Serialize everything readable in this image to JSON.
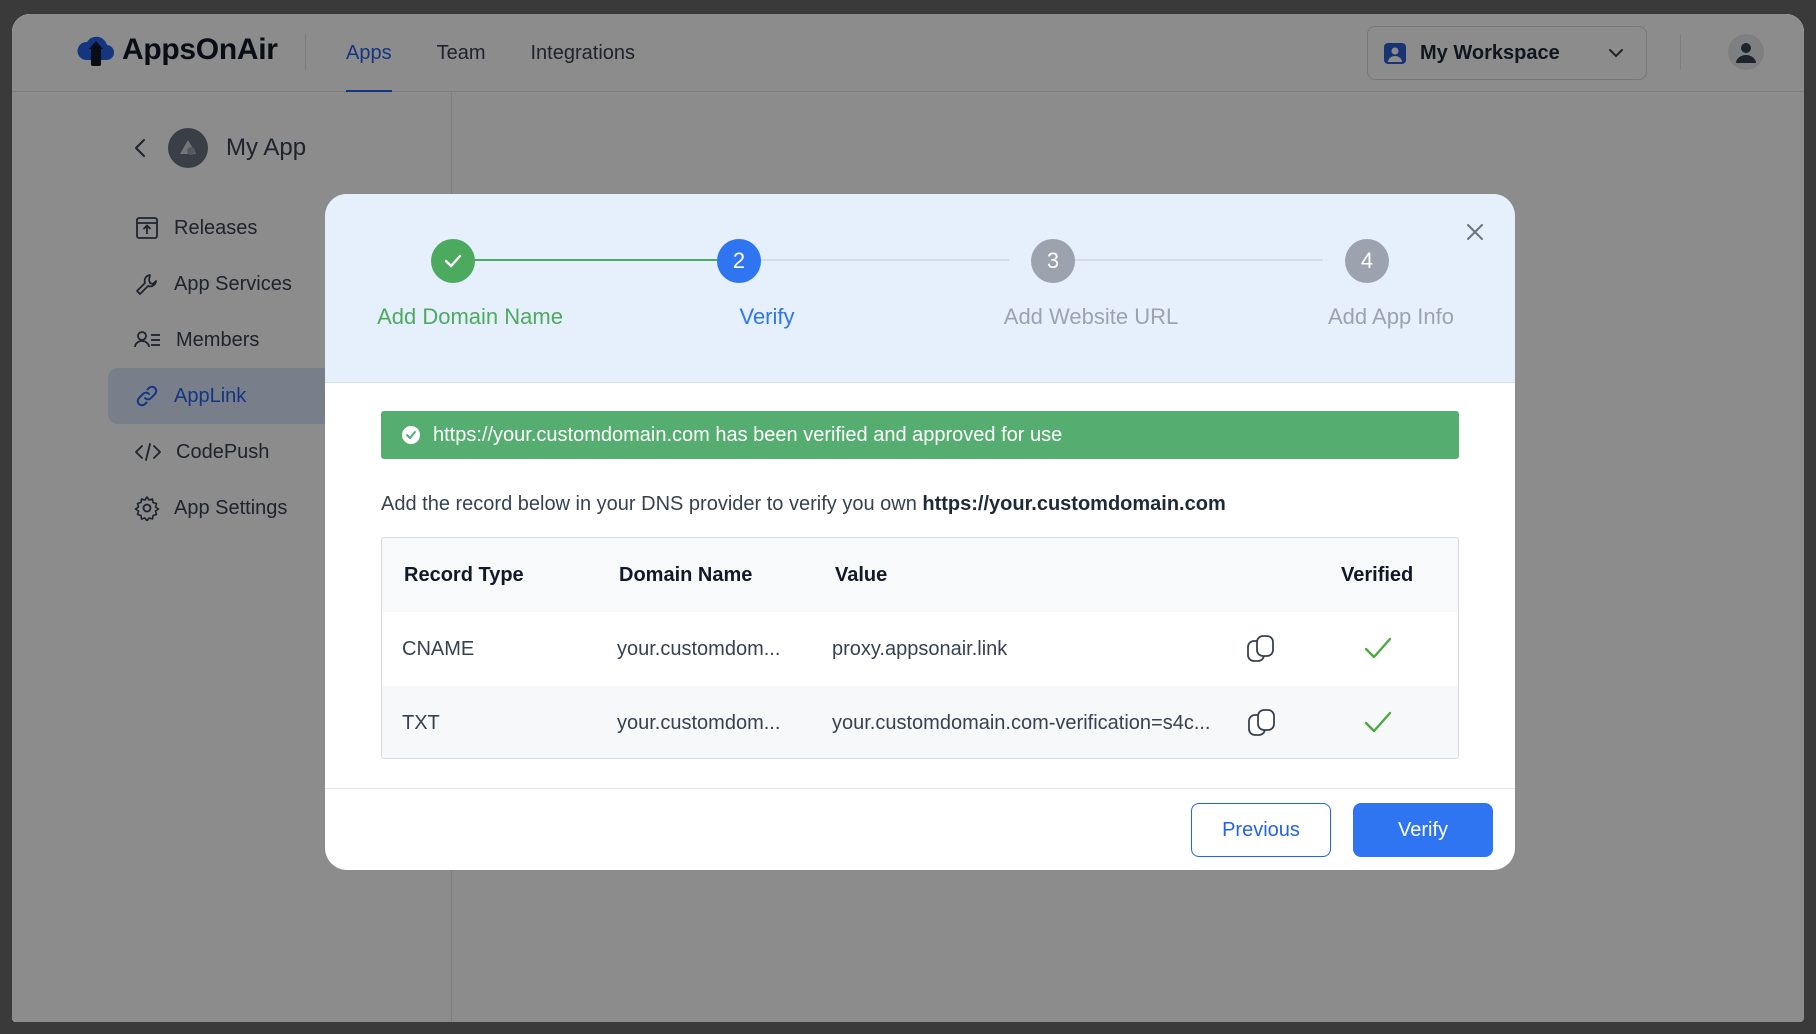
{
  "header": {
    "brand": "AppsOnAir",
    "nav": [
      {
        "label": "Apps",
        "active": true
      },
      {
        "label": "Team"
      },
      {
        "label": "Integrations"
      }
    ],
    "workspace": "My Workspace"
  },
  "sidebar": {
    "app_name": "My App",
    "items": [
      {
        "label": "Releases",
        "icon": "upload-box-icon"
      },
      {
        "label": "App Services",
        "icon": "wrench-icon"
      },
      {
        "label": "Members",
        "icon": "members-icon"
      },
      {
        "label": "AppLink",
        "icon": "link-icon",
        "active": true
      },
      {
        "label": "CodePush",
        "icon": "code-icon"
      },
      {
        "label": "App Settings",
        "icon": "gear-icon"
      }
    ]
  },
  "modal": {
    "steps": [
      {
        "number": "1",
        "label": "Add Domain Name",
        "status": "done"
      },
      {
        "number": "2",
        "label": "Verify",
        "status": "current"
      },
      {
        "number": "3",
        "label": "Add Website URL",
        "status": "pending"
      },
      {
        "number": "4",
        "label": "Add App Info",
        "status": "pending"
      }
    ],
    "alert": "https://your.customdomain.com has been verified and approved for use",
    "description_prefix": "Add the record below in your DNS provider to verify you own",
    "description_domain": "https://your.customdomain.com",
    "table": {
      "headers": [
        "Record Type",
        "Domain Name",
        "Value",
        "Verified"
      ],
      "rows": [
        {
          "type": "CNAME",
          "domain": "your.customdom...",
          "value": "proxy.appsonair.link",
          "verified": true
        },
        {
          "type": "TXT",
          "domain": "your.customdom...",
          "value": "your.customdomain.com-verification=s4c...",
          "verified": true
        }
      ]
    },
    "buttons": {
      "previous": "Previous",
      "verify": "Verify"
    }
  },
  "colors": {
    "accent": "#2563eb",
    "success": "#4caa5f",
    "alert_bg": "#56ad70",
    "step_pending": "#9ca3af"
  }
}
